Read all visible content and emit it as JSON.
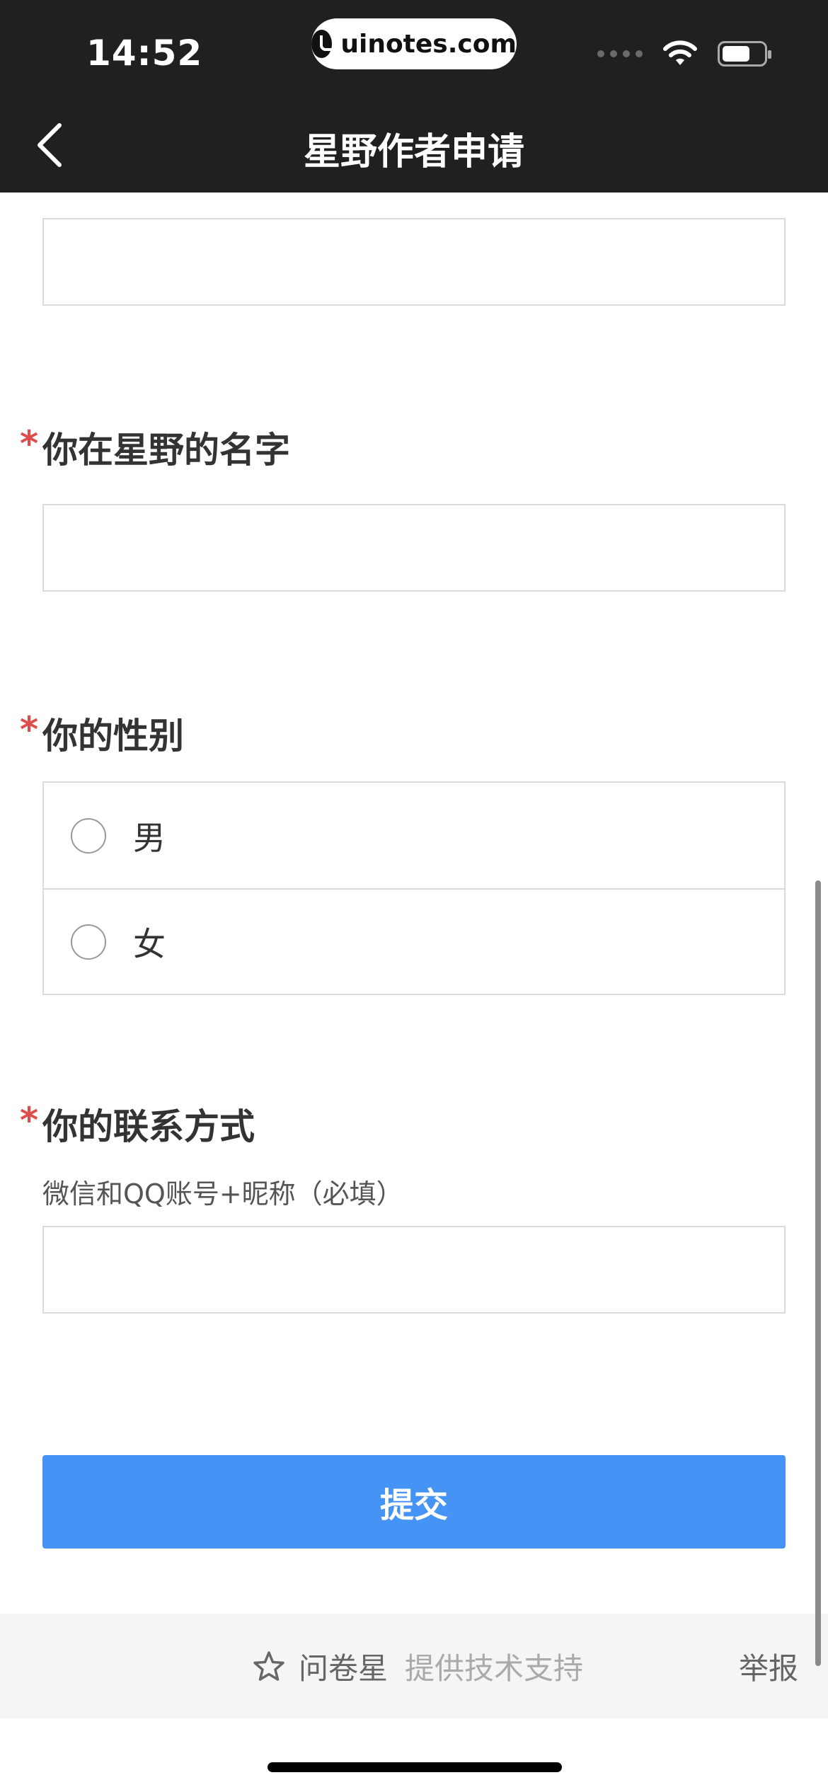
{
  "status_bar": {
    "time": "14:52",
    "url": "uinotes.com"
  },
  "header": {
    "title": "星野作者申请"
  },
  "form": {
    "q_name": {
      "required_mark": "*",
      "label": "你在星野的名字"
    },
    "q_gender": {
      "required_mark": "*",
      "label": "你的性别",
      "options": [
        "男",
        "女"
      ]
    },
    "q_contact": {
      "required_mark": "*",
      "label": "你的联系方式",
      "hint": "微信和QQ账号+昵称（必填）"
    },
    "submit_label": "提交"
  },
  "footer": {
    "brand": "问卷星",
    "support": "提供技术支持",
    "report": "举报"
  },
  "colors": {
    "header_bg": "#1f2022",
    "primary": "#4493f5",
    "required": "#e04b4b"
  }
}
